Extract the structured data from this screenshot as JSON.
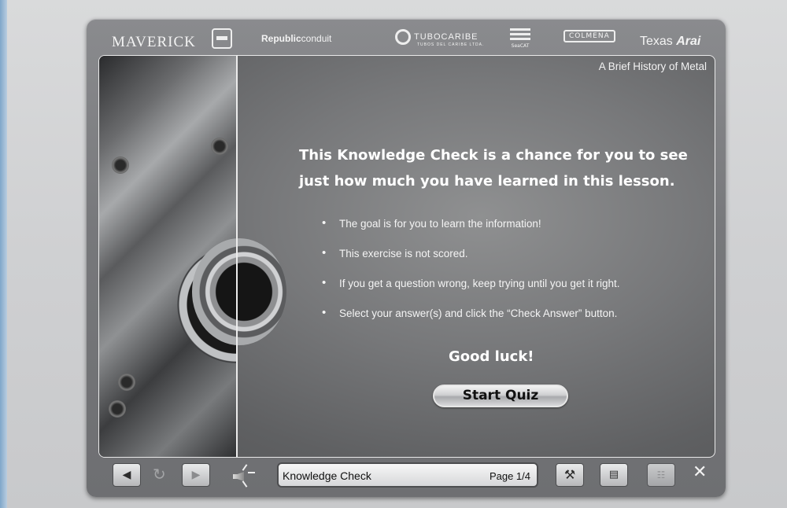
{
  "header": {
    "logos": {
      "maverick": "MAVERICK",
      "republic_bold": "Republic",
      "republic_light": "conduit",
      "tubocaribe": "TUBOCARIBE",
      "tubocaribe_sub": "TUBOS DEL CARIBE LTDA.",
      "seacat": "SeaCAT",
      "colmena": "COLMENA",
      "texas": "Texas",
      "arai": "Arai"
    }
  },
  "screen": {
    "course_title": "A Brief History of Metal",
    "intro_text": "This Knowledge Check is a chance for you to see just how much you have learned in this lesson.",
    "bullets": [
      "The goal is for you to learn the information!",
      "This exercise is not scored.",
      "If you get a question wrong, keep trying until you get it right.",
      "Select your answer(s) and click the “Check Answer” button."
    ],
    "good_luck": "Good luck!",
    "start_button": "Start Quiz"
  },
  "navbar": {
    "status_title": "Knowledge Check",
    "page_label": "Page 1/4",
    "back_icon": "◀",
    "next_icon": "▶",
    "replay_icon": "↻",
    "tools_icon": "⚒",
    "glossary_icon": "▤",
    "map_icon": "☷",
    "close_icon": "✕"
  },
  "icons": [
    "back-arrow-icon",
    "replay-icon",
    "next-arrow-icon",
    "speaker-icon",
    "tools-icon",
    "glossary-book-icon",
    "course-map-icon",
    "close-icon"
  ]
}
